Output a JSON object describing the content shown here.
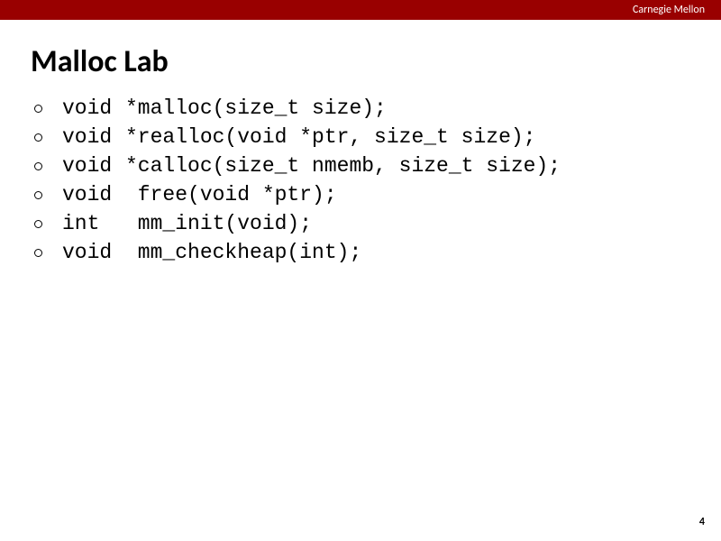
{
  "header": {
    "university": "Carnegie Mellon"
  },
  "title": "Malloc Lab",
  "functions": [
    {
      "ret": "void",
      "sig": "*malloc(size_t size);"
    },
    {
      "ret": "void",
      "sig": "*realloc(void *ptr, size_t size);"
    },
    {
      "ret": "void",
      "sig": "*calloc(size_t nmemb, size_t size);"
    },
    {
      "ret": "void",
      "sig": " free(void *ptr);"
    },
    {
      "ret": "int",
      "sig": " mm_init(void);"
    },
    {
      "ret": "void",
      "sig": " mm_checkheap(int);"
    }
  ],
  "page_number": "4"
}
